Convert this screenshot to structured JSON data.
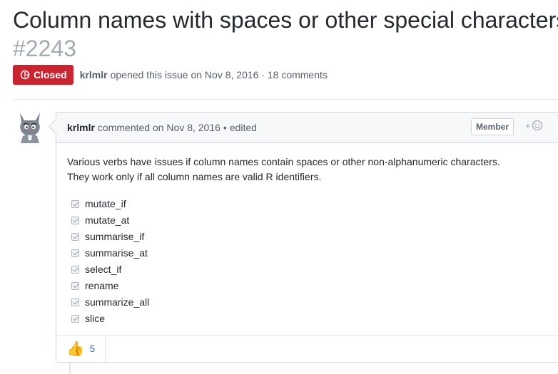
{
  "issue": {
    "title": "Column names with spaces or other special characters",
    "number": "#2243",
    "state": "Closed",
    "author": "krlmlr",
    "opened_text": "opened this issue on Nov 8, 2016 · 18 comments"
  },
  "comment": {
    "author": "krlmlr",
    "commented_text": "commented on Nov 8, 2016",
    "separator": "•",
    "edited_label": "edited",
    "role_badge": "Member",
    "add_reaction_label": "+",
    "body_line1": "Various verbs have issues if column names contain spaces or other non-alphanumeric characters.",
    "body_line2": "They work only if all column names are valid R identifiers.",
    "tasks": [
      {
        "label": "mutate_if",
        "checked": true
      },
      {
        "label": "mutate_at",
        "checked": true
      },
      {
        "label": "summarise_if",
        "checked": true
      },
      {
        "label": "summarise_at",
        "checked": true
      },
      {
        "label": "select_if",
        "checked": true
      },
      {
        "label": "rename",
        "checked": true
      },
      {
        "label": "summarize_all",
        "checked": true
      },
      {
        "label": "slice",
        "checked": true
      }
    ],
    "reaction": {
      "emoji": "👍",
      "icon": "thumbs-up-icon",
      "count": "5"
    }
  },
  "colors": {
    "closed_red": "#cb2431",
    "link_blue": "#0366d6",
    "muted": "#586069",
    "border": "#d1d5da"
  }
}
